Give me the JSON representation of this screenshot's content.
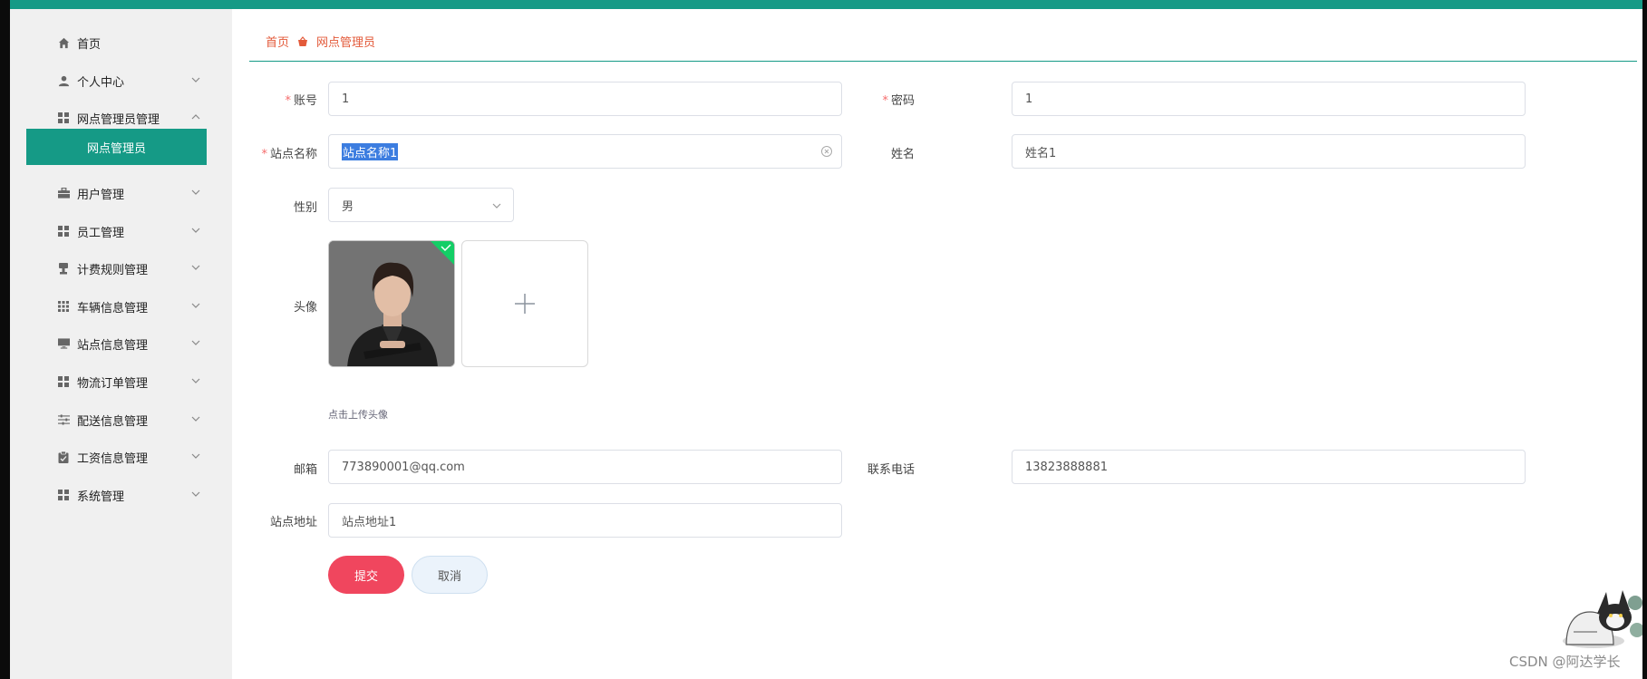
{
  "colors": {
    "accent": "#159a86",
    "breadcrumb": "#e35a3a",
    "submit": "#f0465e",
    "cancel_bg": "#ebf3fb",
    "required": "#f56c6c"
  },
  "sidebar": {
    "items": [
      {
        "label": "首页",
        "icon": "home-icon"
      },
      {
        "label": "个人中心",
        "icon": "user-icon"
      },
      {
        "label": "网点管理员管理",
        "icon": "grid-icon"
      },
      {
        "label": "用户管理",
        "icon": "briefcase-icon"
      },
      {
        "label": "员工管理",
        "icon": "grid-icon"
      },
      {
        "label": "计费规则管理",
        "icon": "stamp-icon"
      },
      {
        "label": "车辆信息管理",
        "icon": "grid-dots-icon"
      },
      {
        "label": "站点信息管理",
        "icon": "monitor-icon"
      },
      {
        "label": "物流订单管理",
        "icon": "grid-icon"
      },
      {
        "label": "配送信息管理",
        "icon": "sliders-icon"
      },
      {
        "label": "工资信息管理",
        "icon": "clipboard-icon"
      },
      {
        "label": "系统管理",
        "icon": "grid-icon"
      }
    ],
    "active_sub": "网点管理员"
  },
  "breadcrumb": {
    "home": "首页",
    "current": "网点管理员"
  },
  "form": {
    "account": {
      "label": "账号",
      "value": "1"
    },
    "password": {
      "label": "密码",
      "value": "1"
    },
    "site_name": {
      "label": "站点名称",
      "value": "站点名称1"
    },
    "name": {
      "label": "姓名",
      "value": "姓名1"
    },
    "gender": {
      "label": "性别",
      "value": "男"
    },
    "avatar": {
      "label": "头像",
      "hint": "点击上传头像"
    },
    "email": {
      "label": "邮箱",
      "value": "773890001@qq.com"
    },
    "phone": {
      "label": "联系电话",
      "value": "13823888881"
    },
    "address": {
      "label": "站点地址",
      "value": "站点地址1"
    }
  },
  "buttons": {
    "submit": "提交",
    "cancel": "取消"
  },
  "watermark": "CSDN @阿达学长"
}
